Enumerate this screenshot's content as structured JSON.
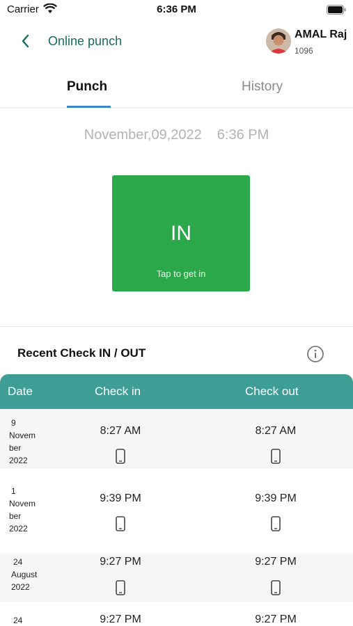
{
  "status_bar": {
    "carrier": "Carrier",
    "time": "6:36 PM"
  },
  "header": {
    "back_icon": "chevron-left-icon",
    "title": "Online punch",
    "user_name": "AMAL Raj",
    "user_id": "1096"
  },
  "tabs": [
    {
      "label": "Punch",
      "active": true
    },
    {
      "label": "History",
      "active": false
    }
  ],
  "current": {
    "date": "November,09,2022",
    "time": "6:36 PM"
  },
  "punch_button": {
    "label": "IN",
    "subtitle": "Tap to get in",
    "color": "#2aa84a"
  },
  "recent": {
    "title": "Recent Check IN / OUT",
    "info_icon": "info-icon",
    "columns": [
      "Date",
      "Check in",
      "Check out"
    ],
    "rows": [
      {
        "date_lines": [
          "9",
          "Novem",
          "ber",
          "2022"
        ],
        "check_in": "8:27 AM",
        "check_out": "8:27 AM"
      },
      {
        "date_lines": [
          "1",
          "Novem",
          "ber",
          "2022"
        ],
        "check_in": "9:39 PM",
        "check_out": "9:39 PM"
      },
      {
        "date_lines": [
          "24",
          "August",
          "2022"
        ],
        "check_in": "9:27 PM",
        "check_out": "9:27 PM"
      },
      {
        "date_lines": [
          "24"
        ],
        "check_in": "9:27 PM",
        "check_out": "9:27 PM"
      }
    ]
  },
  "colors": {
    "accent": "#3e9e96",
    "title_green": "#166a5f",
    "tab_indicator": "#3a86c9"
  }
}
